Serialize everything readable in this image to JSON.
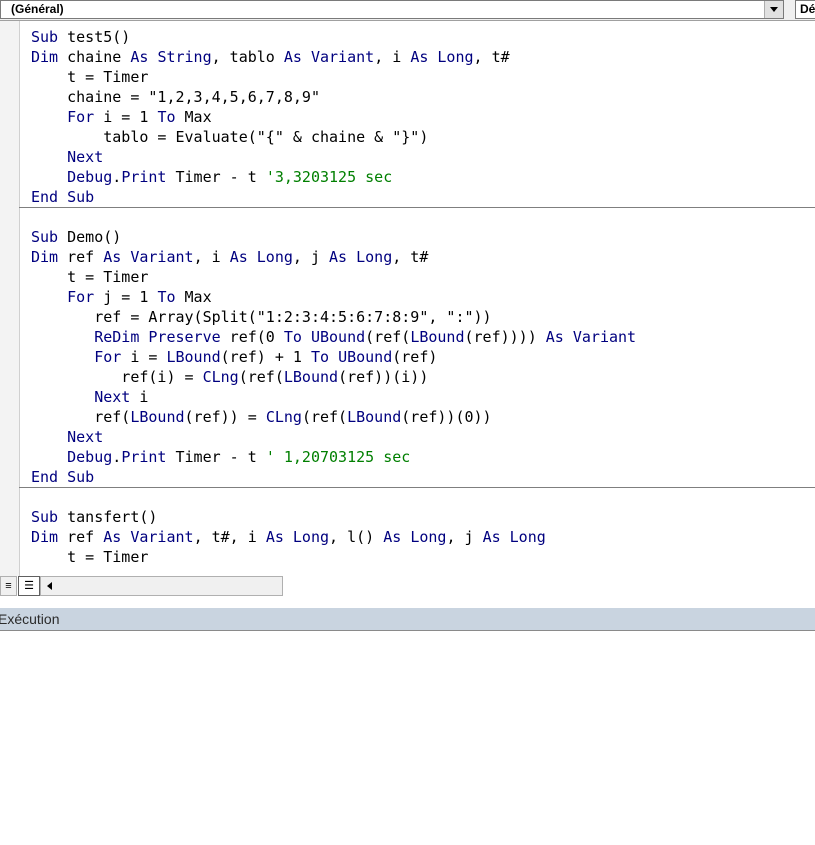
{
  "combo": {
    "object_value": "(Général)",
    "procedure_value": "Dé"
  },
  "code": {
    "procedures": [
      {
        "lines": [
          [
            {
              "t": "Sub",
              "k": "kw"
            },
            {
              "t": " test5()"
            }
          ],
          [
            {
              "t": "Dim",
              "k": "kw"
            },
            {
              "t": " chaine "
            },
            {
              "t": "As",
              "k": "kw"
            },
            {
              "t": " "
            },
            {
              "t": "String",
              "k": "kw"
            },
            {
              "t": ", tablo "
            },
            {
              "t": "As",
              "k": "kw"
            },
            {
              "t": " "
            },
            {
              "t": "Variant",
              "k": "kw"
            },
            {
              "t": ", i "
            },
            {
              "t": "As",
              "k": "kw"
            },
            {
              "t": " "
            },
            {
              "t": "Long",
              "k": "kw"
            },
            {
              "t": ", t#"
            }
          ],
          [
            {
              "t": "    t = Timer"
            }
          ],
          [
            {
              "t": "    chaine = \"1,2,3,4,5,6,7,8,9\""
            }
          ],
          [
            {
              "t": "    "
            },
            {
              "t": "For",
              "k": "kw"
            },
            {
              "t": " i = 1 "
            },
            {
              "t": "To",
              "k": "kw"
            },
            {
              "t": " Max"
            }
          ],
          [
            {
              "t": "        tablo = Evaluate(\"{\" & chaine & \"}\")"
            }
          ],
          [
            {
              "t": "    "
            },
            {
              "t": "Next",
              "k": "kw"
            }
          ],
          [
            {
              "t": "    "
            },
            {
              "t": "Debug",
              "k": "kw"
            },
            {
              "t": "."
            },
            {
              "t": "Print",
              "k": "kw"
            },
            {
              "t": " Timer - t "
            },
            {
              "t": "'3,3203125 sec",
              "k": "cm"
            }
          ],
          [
            {
              "t": "End",
              "k": "kw"
            },
            {
              "t": " "
            },
            {
              "t": "Sub",
              "k": "kw"
            }
          ]
        ]
      },
      {
        "lines": [
          [
            {
              "t": ""
            }
          ],
          [
            {
              "t": "Sub",
              "k": "kw"
            },
            {
              "t": " Demo()"
            }
          ],
          [
            {
              "t": "Dim",
              "k": "kw"
            },
            {
              "t": " ref "
            },
            {
              "t": "As",
              "k": "kw"
            },
            {
              "t": " "
            },
            {
              "t": "Variant",
              "k": "kw"
            },
            {
              "t": ", i "
            },
            {
              "t": "As",
              "k": "kw"
            },
            {
              "t": " "
            },
            {
              "t": "Long",
              "k": "kw"
            },
            {
              "t": ", j "
            },
            {
              "t": "As",
              "k": "kw"
            },
            {
              "t": " "
            },
            {
              "t": "Long",
              "k": "kw"
            },
            {
              "t": ", t#"
            }
          ],
          [
            {
              "t": "    t = Timer"
            }
          ],
          [
            {
              "t": "    "
            },
            {
              "t": "For",
              "k": "kw"
            },
            {
              "t": " j = 1 "
            },
            {
              "t": "To",
              "k": "kw"
            },
            {
              "t": " Max"
            }
          ],
          [
            {
              "t": "       ref = Array(Split(\"1:2:3:4:5:6:7:8:9\", \":\"))"
            }
          ],
          [
            {
              "t": "       "
            },
            {
              "t": "ReDim",
              "k": "kw"
            },
            {
              "t": " "
            },
            {
              "t": "Preserve",
              "k": "kw"
            },
            {
              "t": " ref(0 "
            },
            {
              "t": "To",
              "k": "kw"
            },
            {
              "t": " "
            },
            {
              "t": "UBound",
              "k": "kw"
            },
            {
              "t": "(ref("
            },
            {
              "t": "LBound",
              "k": "kw"
            },
            {
              "t": "(ref)))) "
            },
            {
              "t": "As",
              "k": "kw"
            },
            {
              "t": " "
            },
            {
              "t": "Variant",
              "k": "kw"
            }
          ],
          [
            {
              "t": "       "
            },
            {
              "t": "For",
              "k": "kw"
            },
            {
              "t": " i = "
            },
            {
              "t": "LBound",
              "k": "kw"
            },
            {
              "t": "(ref) + 1 "
            },
            {
              "t": "To",
              "k": "kw"
            },
            {
              "t": " "
            },
            {
              "t": "UBound",
              "k": "kw"
            },
            {
              "t": "(ref)"
            }
          ],
          [
            {
              "t": "          ref(i) = "
            },
            {
              "t": "CLng",
              "k": "kw"
            },
            {
              "t": "(ref("
            },
            {
              "t": "LBound",
              "k": "kw"
            },
            {
              "t": "(ref))(i))"
            }
          ],
          [
            {
              "t": "       "
            },
            {
              "t": "Next",
              "k": "kw"
            },
            {
              "t": " i"
            }
          ],
          [
            {
              "t": "       ref("
            },
            {
              "t": "LBound",
              "k": "kw"
            },
            {
              "t": "(ref)) = "
            },
            {
              "t": "CLng",
              "k": "kw"
            },
            {
              "t": "(ref("
            },
            {
              "t": "LBound",
              "k": "kw"
            },
            {
              "t": "(ref))(0))"
            }
          ],
          [
            {
              "t": "    "
            },
            {
              "t": "Next",
              "k": "kw"
            }
          ],
          [
            {
              "t": "    "
            },
            {
              "t": "Debug",
              "k": "kw"
            },
            {
              "t": "."
            },
            {
              "t": "Print",
              "k": "kw"
            },
            {
              "t": " Timer - t "
            },
            {
              "t": "' 1,20703125 sec",
              "k": "cm"
            }
          ],
          [
            {
              "t": "End",
              "k": "kw"
            },
            {
              "t": " "
            },
            {
              "t": "Sub",
              "k": "kw"
            }
          ]
        ]
      },
      {
        "lines": [
          [
            {
              "t": ""
            }
          ],
          [
            {
              "t": "Sub",
              "k": "kw"
            },
            {
              "t": " tansfert()"
            }
          ],
          [
            {
              "t": "Dim",
              "k": "kw"
            },
            {
              "t": " ref "
            },
            {
              "t": "As",
              "k": "kw"
            },
            {
              "t": " "
            },
            {
              "t": "Variant",
              "k": "kw"
            },
            {
              "t": ", t#, i "
            },
            {
              "t": "As",
              "k": "kw"
            },
            {
              "t": " "
            },
            {
              "t": "Long",
              "k": "kw"
            },
            {
              "t": ", l() "
            },
            {
              "t": "As",
              "k": "kw"
            },
            {
              "t": " "
            },
            {
              "t": "Long",
              "k": "kw"
            },
            {
              "t": ", j "
            },
            {
              "t": "As",
              "k": "kw"
            },
            {
              "t": " "
            },
            {
              "t": "Long",
              "k": "kw"
            }
          ],
          [
            {
              "t": "    t = Timer"
            }
          ]
        ]
      }
    ]
  },
  "footer": {
    "procedure_view_icon": "procedure-view-icon",
    "full_module_view_icon": "full-module-view-icon",
    "scroll_left_icon": "scroll-left-icon"
  },
  "exec_panel": {
    "title": "Exécution"
  },
  "colors": {
    "keyword": "#00007f",
    "comment": "#007f00",
    "text": "#000000"
  }
}
